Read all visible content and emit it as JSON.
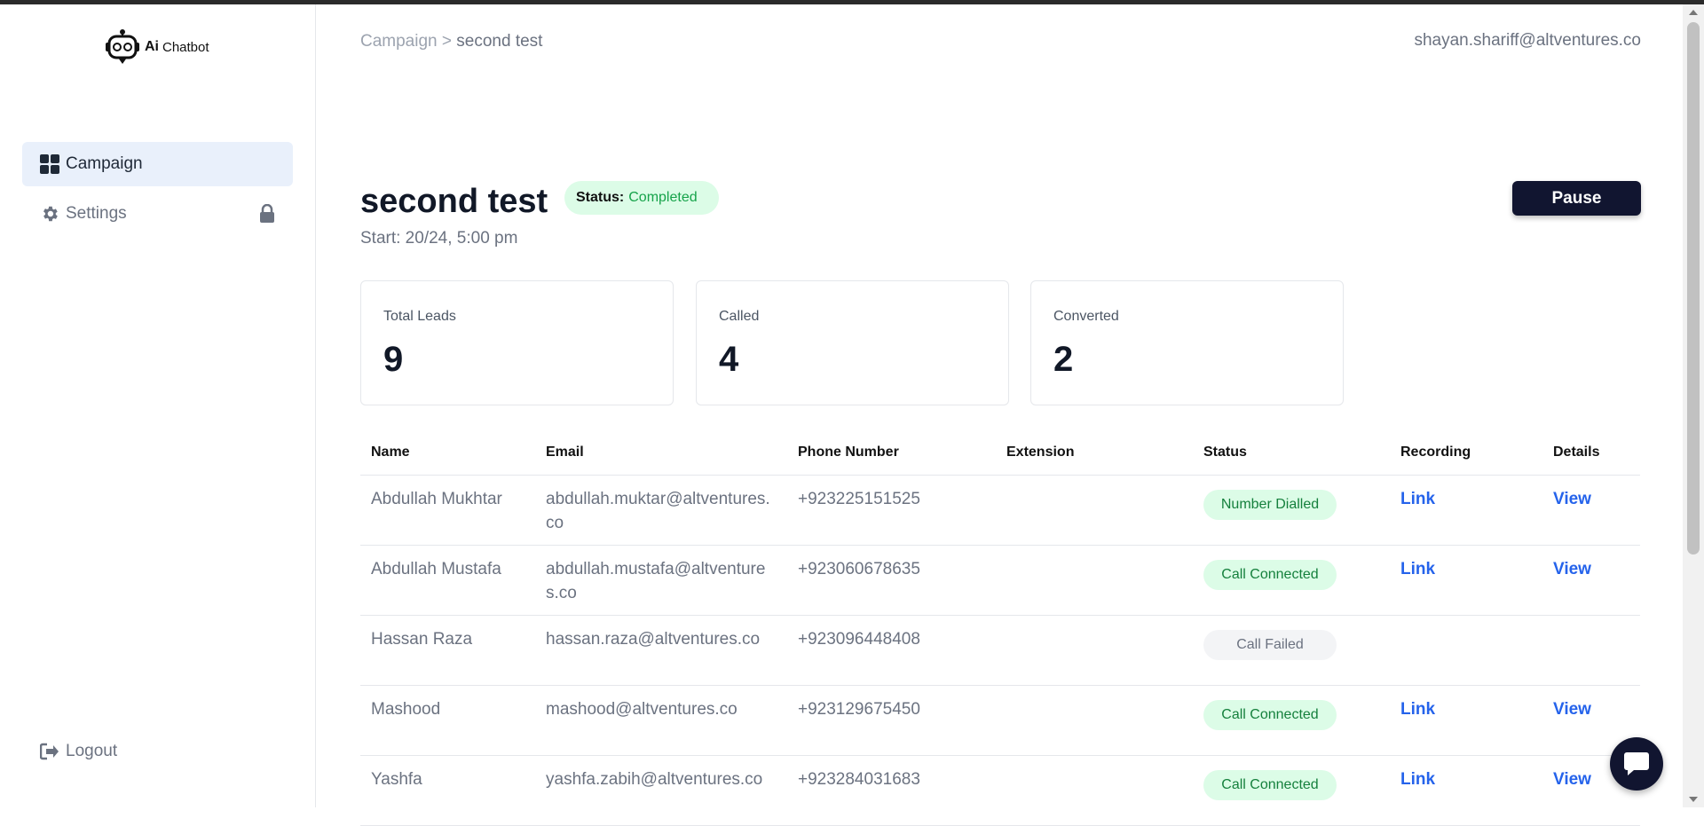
{
  "app": {
    "logo_ai": "Ai",
    "logo_name": "Chatbot"
  },
  "sidebar": {
    "items": [
      {
        "label": "Campaign",
        "icon": "grid-icon",
        "active": true
      },
      {
        "label": "Settings",
        "icon": "gear-icon",
        "locked": true
      }
    ],
    "logout_label": "Logout"
  },
  "header": {
    "breadcrumb_root": "Campaign",
    "breadcrumb_sep": ">",
    "breadcrumb_current": "second test",
    "user_email": "shayan.shariff@altventures.co"
  },
  "campaign": {
    "title": "second test",
    "status_label": "Status:",
    "status_value": "Completed",
    "start": "Start: 20/24, 5:00 pm",
    "pause_label": "Pause"
  },
  "stats": [
    {
      "label": "Total Leads",
      "value": "9"
    },
    {
      "label": "Called",
      "value": "4"
    },
    {
      "label": "Converted",
      "value": "2"
    }
  ],
  "table": {
    "headers": [
      "Name",
      "Email",
      "Phone Number",
      "Extension",
      "Status",
      "Recording",
      "Details"
    ],
    "rows": [
      {
        "name": "Abdullah Mukhtar",
        "email": "abdullah.muktar@altventures.co",
        "phone": "+923225151525",
        "extension": "",
        "status": "Number Dialled",
        "status_tone": "green",
        "recording": "Link",
        "details": "View"
      },
      {
        "name": "Abdullah Mustafa",
        "email": "abdullah.mustafa@altventures.co",
        "phone": "+923060678635",
        "extension": "",
        "status": "Call Connected",
        "status_tone": "green",
        "recording": "Link",
        "details": "View"
      },
      {
        "name": "Hassan Raza",
        "email": "hassan.raza@altventures.co",
        "phone": "+923096448408",
        "extension": "",
        "status": "Call Failed",
        "status_tone": "gray",
        "recording": "",
        "details": ""
      },
      {
        "name": "Mashood",
        "email": "mashood@altventures.co",
        "phone": "+923129675450",
        "extension": "",
        "status": "Call Connected",
        "status_tone": "green",
        "recording": "Link",
        "details": "View"
      },
      {
        "name": "Yashfa",
        "email": "yashfa.zabih@altventures.co",
        "phone": "+923284031683",
        "extension": "",
        "status": "Call Connected",
        "status_tone": "green",
        "recording": "Link",
        "details": "View"
      }
    ]
  },
  "colors": {
    "accent": "#111530",
    "link": "#2563eb",
    "success_bg": "#dcfce7",
    "success_text": "#15803d"
  }
}
